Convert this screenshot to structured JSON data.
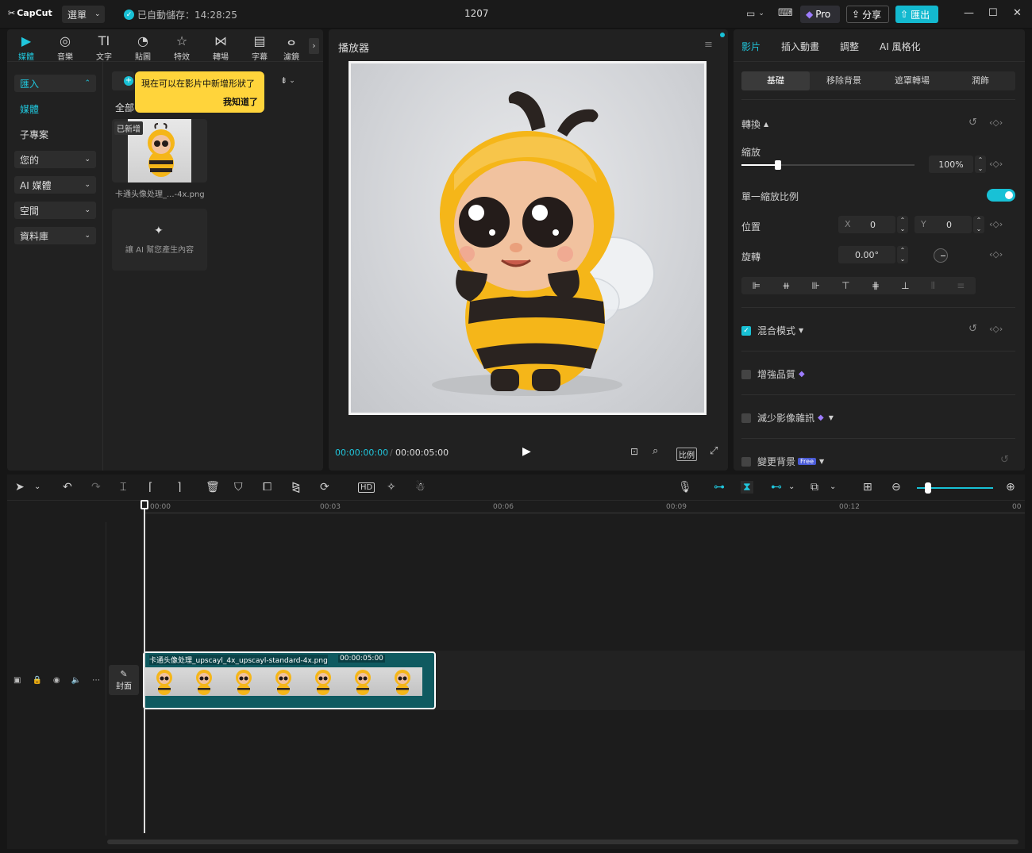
{
  "titlebar": {
    "logo": "CapCut",
    "menu_label": "選單",
    "save_status": "已自動儲存：14:28:25",
    "project_title": "1207",
    "pro_label": "Pro",
    "share_label": "分享",
    "export_label": "匯出"
  },
  "left_tools": [
    {
      "label": "媒體",
      "icon": "media-icon"
    },
    {
      "label": "音樂",
      "icon": "music-icon"
    },
    {
      "label": "文字",
      "icon": "text-icon"
    },
    {
      "label": "貼圖",
      "icon": "sticker-icon"
    },
    {
      "label": "特效",
      "icon": "effects-icon"
    },
    {
      "label": "轉場",
      "icon": "transition-icon"
    },
    {
      "label": "字幕",
      "icon": "caption-icon"
    },
    {
      "label": "濾鏡",
      "icon": "filter-icon"
    }
  ],
  "sidebar": {
    "import_label": "匯入",
    "media_label": "媒體",
    "subproject_label": "子專案",
    "yours_label": "您的",
    "ai_media_label": "AI 媒體",
    "space_label": "空間",
    "library_label": "資料庫"
  },
  "media": {
    "all_label": "全部",
    "added_badge": "已新增",
    "file_name": "卡通头像处理_...-4x.png",
    "ai_card_label": "讓 AI 幫您產生內容",
    "tooltip_text": "現在可以在影片中新增形狀了",
    "tooltip_ok": "我知道了"
  },
  "player": {
    "title": "播放器",
    "current_time": "00:00:00:00",
    "total_time": "00:00:05:00",
    "ratio_label": "比例"
  },
  "props": {
    "tabs": [
      "影片",
      "插入動畫",
      "調整",
      "AI 風格化"
    ],
    "subtabs": [
      "基礎",
      "移除背景",
      "遮罩轉場",
      "潤飾"
    ],
    "transform_label": "轉換",
    "scale_label": "縮放",
    "scale_value": "100%",
    "uniform_scale_label": "單一縮放比例",
    "position_label": "位置",
    "pos_x_label": "X",
    "pos_x_value": "0",
    "pos_y_label": "Y",
    "pos_y_value": "0",
    "rotate_label": "旋轉",
    "rotate_value": "0.00°",
    "blend_label": "混合模式",
    "enhance_label": "增強品質",
    "denoise_label": "減少影像雜訊",
    "bg_label": "變更背景",
    "free_badge": "Free"
  },
  "timeline": {
    "ruler": [
      "00:00",
      "00:03",
      "00:06",
      "00:09",
      "00:12",
      "00"
    ],
    "clip_name": "卡通头像处理_upscayl_4x_upscayl-standard-4x.png",
    "clip_duration": "00:00:05:00",
    "cover_label": "封面"
  },
  "colors": {
    "accent": "#18c1d6",
    "tooltip": "#ffd43b",
    "clip": "#0f5a60"
  }
}
